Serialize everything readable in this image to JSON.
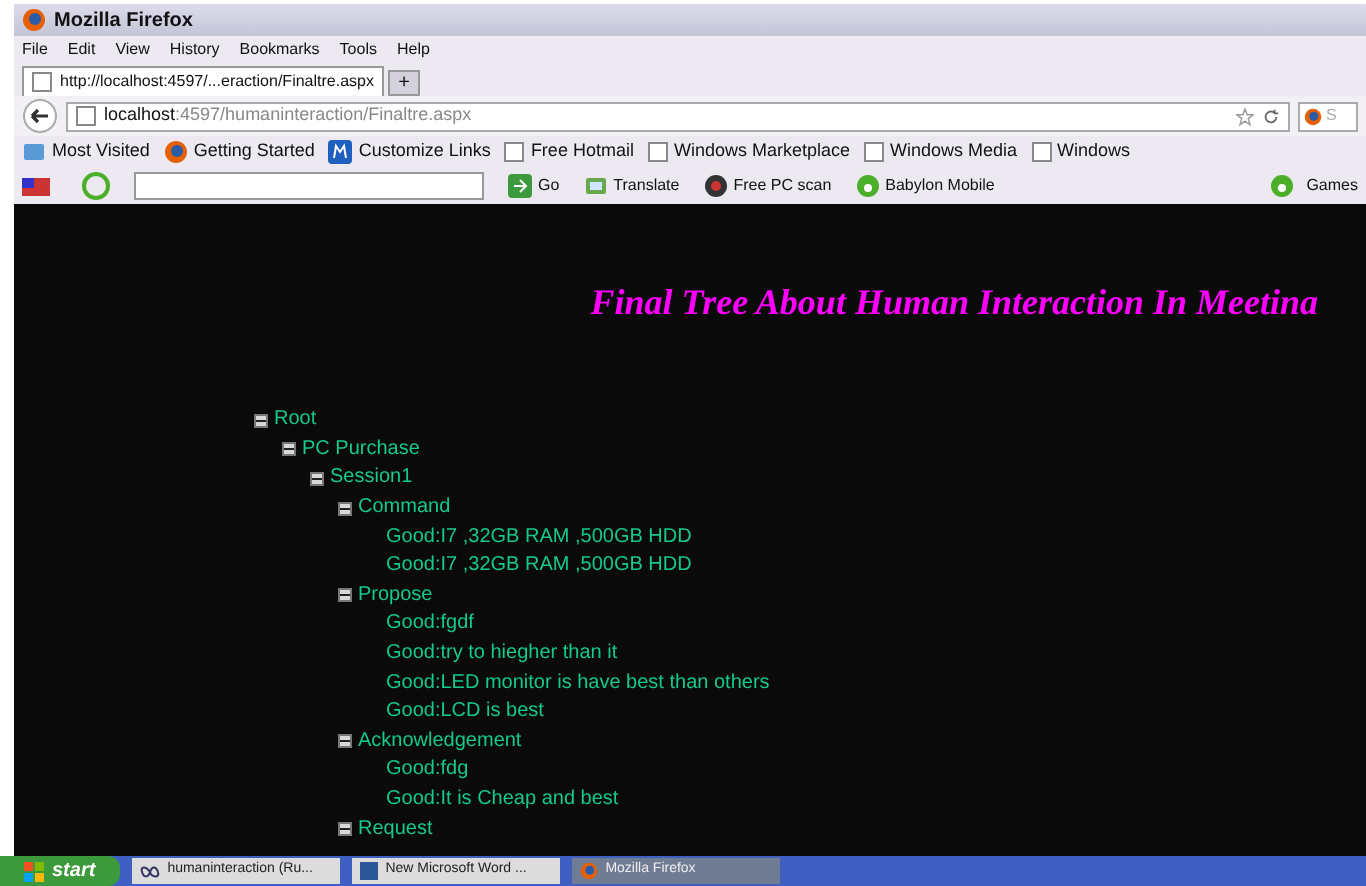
{
  "window": {
    "title": "Mozilla Firefox"
  },
  "menu": [
    "File",
    "Edit",
    "View",
    "History",
    "Bookmarks",
    "Tools",
    "Help"
  ],
  "tabs": [
    {
      "label": "http://localhost:4597/...eraction/Finaltre.aspx",
      "selected": true
    }
  ],
  "new_tab": "+",
  "address": {
    "host": "localhost",
    "path": ":4597/humaninteraction/Finaltre.aspx",
    "search_placeholder": "S"
  },
  "bookmarks": [
    {
      "label": "Most Visited",
      "kind": "folder"
    },
    {
      "label": "Getting Started",
      "kind": "firefox"
    },
    {
      "label": "Customize Links",
      "kind": "m"
    },
    {
      "label": "Free Hotmail",
      "kind": "page"
    },
    {
      "label": "Windows Marketplace",
      "kind": "page"
    },
    {
      "label": "Windows Media",
      "kind": "page"
    },
    {
      "label": "Windows",
      "kind": "page"
    }
  ],
  "toolbar": [
    {
      "label": "Go",
      "kind": "go"
    },
    {
      "label": "Translate",
      "kind": "translate"
    },
    {
      "label": "Free PC scan",
      "kind": "scan"
    },
    {
      "label": "Babylon Mobile",
      "kind": "babylon"
    }
  ],
  "toolbar_right": "Games",
  "page": {
    "heading": "Final Tree About Human Interaction In Meetina",
    "tree": [
      {
        "label": "Root",
        "expanded": true,
        "children": [
          {
            "label": "PC Purchase",
            "expanded": true,
            "children": [
              {
                "label": "Session1",
                "expanded": true,
                "children": [
                  {
                    "label": "Command",
                    "expanded": true,
                    "children": [
                      {
                        "label": "Good:I7 ,32GB RAM ,500GB HDD"
                      },
                      {
                        "label": "Good:I7 ,32GB RAM ,500GB HDD"
                      }
                    ]
                  },
                  {
                    "label": "Propose",
                    "expanded": true,
                    "children": [
                      {
                        "label": "Good:fgdf"
                      },
                      {
                        "label": "Good:try to hiegher than it"
                      },
                      {
                        "label": "Good:LED monitor is have best than others"
                      },
                      {
                        "label": "Good:LCD is best"
                      }
                    ]
                  },
                  {
                    "label": "Acknowledgement",
                    "expanded": true,
                    "children": [
                      {
                        "label": "Good:fdg"
                      },
                      {
                        "label": "Good:It is Cheap and best"
                      }
                    ]
                  },
                  {
                    "label": "Request",
                    "expanded": true
                  }
                ]
              }
            ]
          }
        ]
      }
    ]
  },
  "taskbar": {
    "start": "start",
    "items": [
      {
        "label": "humaninteraction (Ru...",
        "selected": false,
        "kind": "vs"
      },
      {
        "label": "New Microsoft Word ...",
        "selected": false,
        "kind": "word"
      },
      {
        "label": "Mozilla Firefox",
        "selected": true,
        "kind": "firefox"
      }
    ]
  }
}
